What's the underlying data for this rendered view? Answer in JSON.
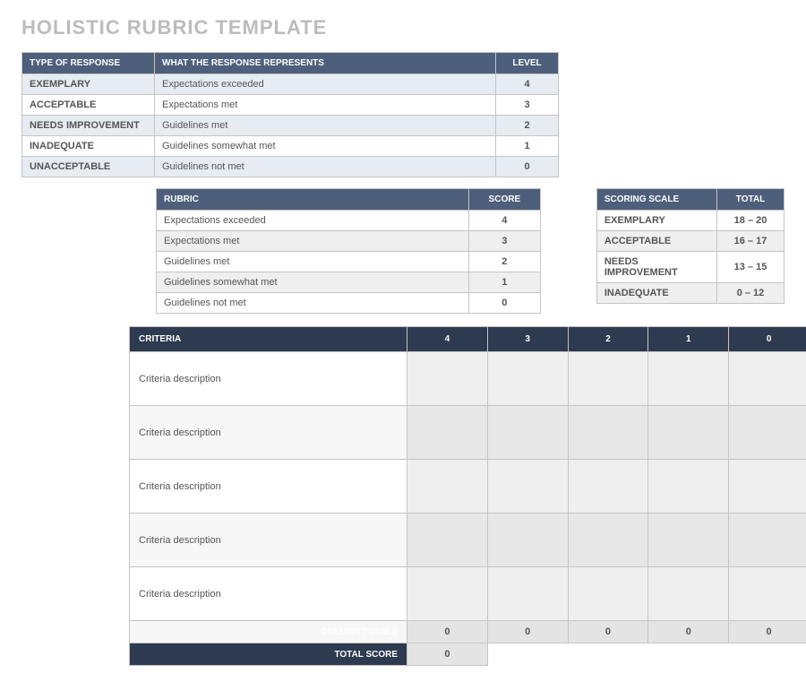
{
  "title": "HOLISTIC RUBRIC TEMPLATE",
  "response_table": {
    "headers": {
      "type": "TYPE OF RESPONSE",
      "represents": "WHAT THE RESPONSE REPRESENTS",
      "level": "LEVEL"
    },
    "rows": [
      {
        "type": "EXEMPLARY",
        "represents": "Expectations exceeded",
        "level": "4"
      },
      {
        "type": "ACCEPTABLE",
        "represents": "Expectations met",
        "level": "3"
      },
      {
        "type": "NEEDS IMPROVEMENT",
        "represents": "Guidelines met",
        "level": "2"
      },
      {
        "type": "INADEQUATE",
        "represents": "Guidelines somewhat met",
        "level": "1"
      },
      {
        "type": "UNACCEPTABLE",
        "represents": "Guidelines not met",
        "level": "0"
      }
    ]
  },
  "rubric_table": {
    "headers": {
      "rubric": "RUBRIC",
      "score": "SCORE"
    },
    "rows": [
      {
        "rubric": "Expectations exceeded",
        "score": "4"
      },
      {
        "rubric": "Expectations met",
        "score": "3"
      },
      {
        "rubric": "Guidelines met",
        "score": "2"
      },
      {
        "rubric": "Guidelines somewhat met",
        "score": "1"
      },
      {
        "rubric": "Guidelines not met",
        "score": "0"
      }
    ]
  },
  "scoring_scale": {
    "headers": {
      "name": "SCORING SCALE",
      "total": "TOTAL"
    },
    "rows": [
      {
        "name": "EXEMPLARY",
        "total": "18 – 20"
      },
      {
        "name": "ACCEPTABLE",
        "total": "16 – 17"
      },
      {
        "name": "NEEDS IMPROVEMENT",
        "total": "13 – 15"
      },
      {
        "name": "INADEQUATE",
        "total": "0 – 12"
      }
    ]
  },
  "criteria_table": {
    "headers": {
      "criteria": "CRITERIA",
      "cols": [
        "4",
        "3",
        "2",
        "1",
        "0"
      ]
    },
    "rows": [
      {
        "criteria": "Criteria description"
      },
      {
        "criteria": "Criteria description"
      },
      {
        "criteria": "Criteria description"
      },
      {
        "criteria": "Criteria description"
      },
      {
        "criteria": "Criteria description"
      }
    ],
    "column_totals_label": "COLUMN TOTALS",
    "column_totals": [
      "0",
      "0",
      "0",
      "0",
      "0"
    ],
    "total_score_label": "TOTAL SCORE",
    "total_score": "0"
  }
}
